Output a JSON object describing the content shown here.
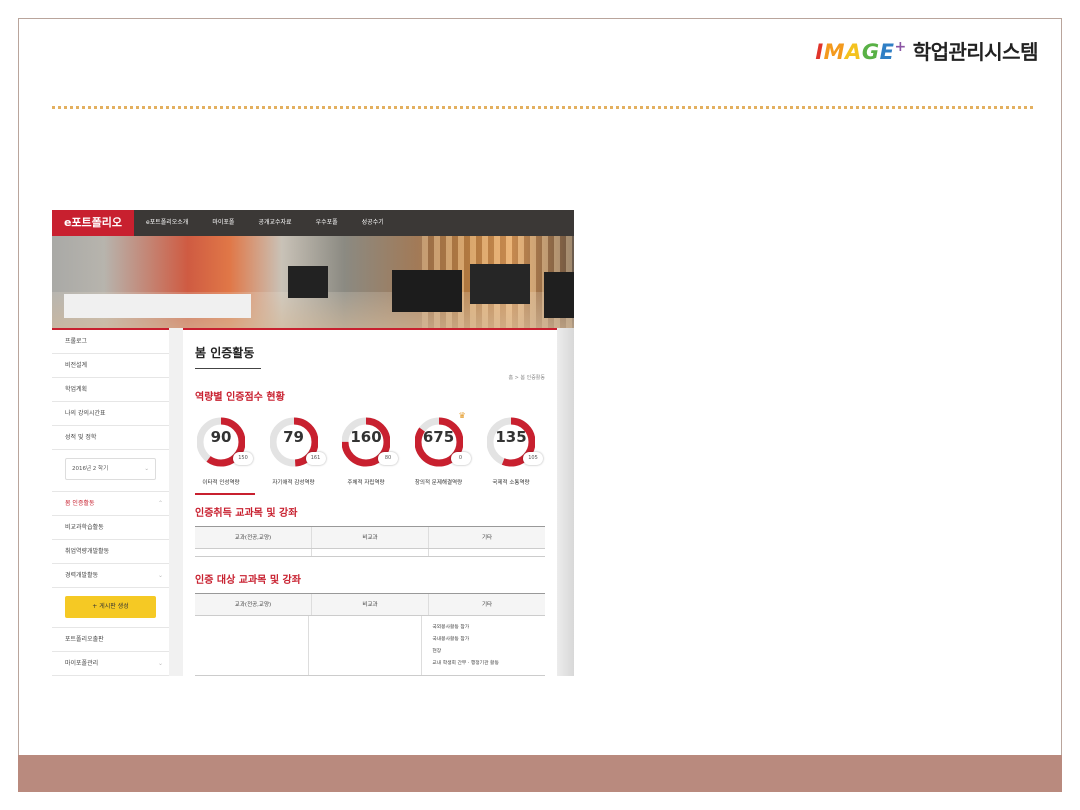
{
  "slide": {
    "brand_logo": [
      "I",
      "M",
      "A",
      "G",
      "E"
    ],
    "brand_plus": "+",
    "brand_title": "학업관리시스템"
  },
  "portfolio": {
    "nav": {
      "brand": "e포트폴리오",
      "items": [
        "e포트폴리오소개",
        "마이포폴",
        "공개교수자료",
        "우수포폴",
        "성공수기"
      ]
    },
    "sidebar": {
      "items_top": [
        "프롤로그",
        "비전설계",
        "학업계획",
        "나의 강의시간표",
        "성적 및 정학"
      ],
      "select_value": "2016년 2 학기",
      "items_mid": [
        "봄 인증활동",
        "비교과학습활동",
        "취업역량개발활동",
        "경력개발활동"
      ],
      "button_label": "+ 게시판 생성",
      "items_bottom": [
        "포트폴리오출판",
        "마이포폴관리"
      ]
    },
    "content": {
      "title": "봄 인증활동",
      "breadcrumb": "홈 > 봄 인증활동",
      "section_score": "역량별 인증점수 현황",
      "gauges": [
        {
          "value": "90",
          "badge": "150",
          "label": "이타적 인성역량",
          "fill": 0.6
        },
        {
          "value": "79",
          "badge": "161",
          "label": "자기애적 감성역량",
          "fill": 0.49
        },
        {
          "value": "160",
          "badge": "80",
          "label": "주체적 자립역량",
          "fill": 0.75
        },
        {
          "value": "675",
          "badge": "0",
          "label": "창의적 문제해결역량",
          "fill": 0.85
        },
        {
          "value": "135",
          "badge": "105",
          "label": "국제적 소통역량",
          "fill": 0.56
        }
      ],
      "section_acquired": "인증취득 교과목 및 강좌",
      "table_headers": [
        "교과(전공,교양)",
        "비교과",
        "기타"
      ],
      "section_target": "인증 대상 교과목 및 강좌",
      "etc_items": [
        "국외봉사활동 참가",
        "국내봉사활동 참가",
        "현장",
        "교내 학생회 간부 · 행정기관 활동"
      ]
    }
  },
  "colors": {
    "accent_red": "#c8202f",
    "gauge_track": "#e3e3e3",
    "button_yellow": "#f5c924",
    "footer_band": "#b98a7e",
    "dotted_rule": "#e3b060"
  }
}
